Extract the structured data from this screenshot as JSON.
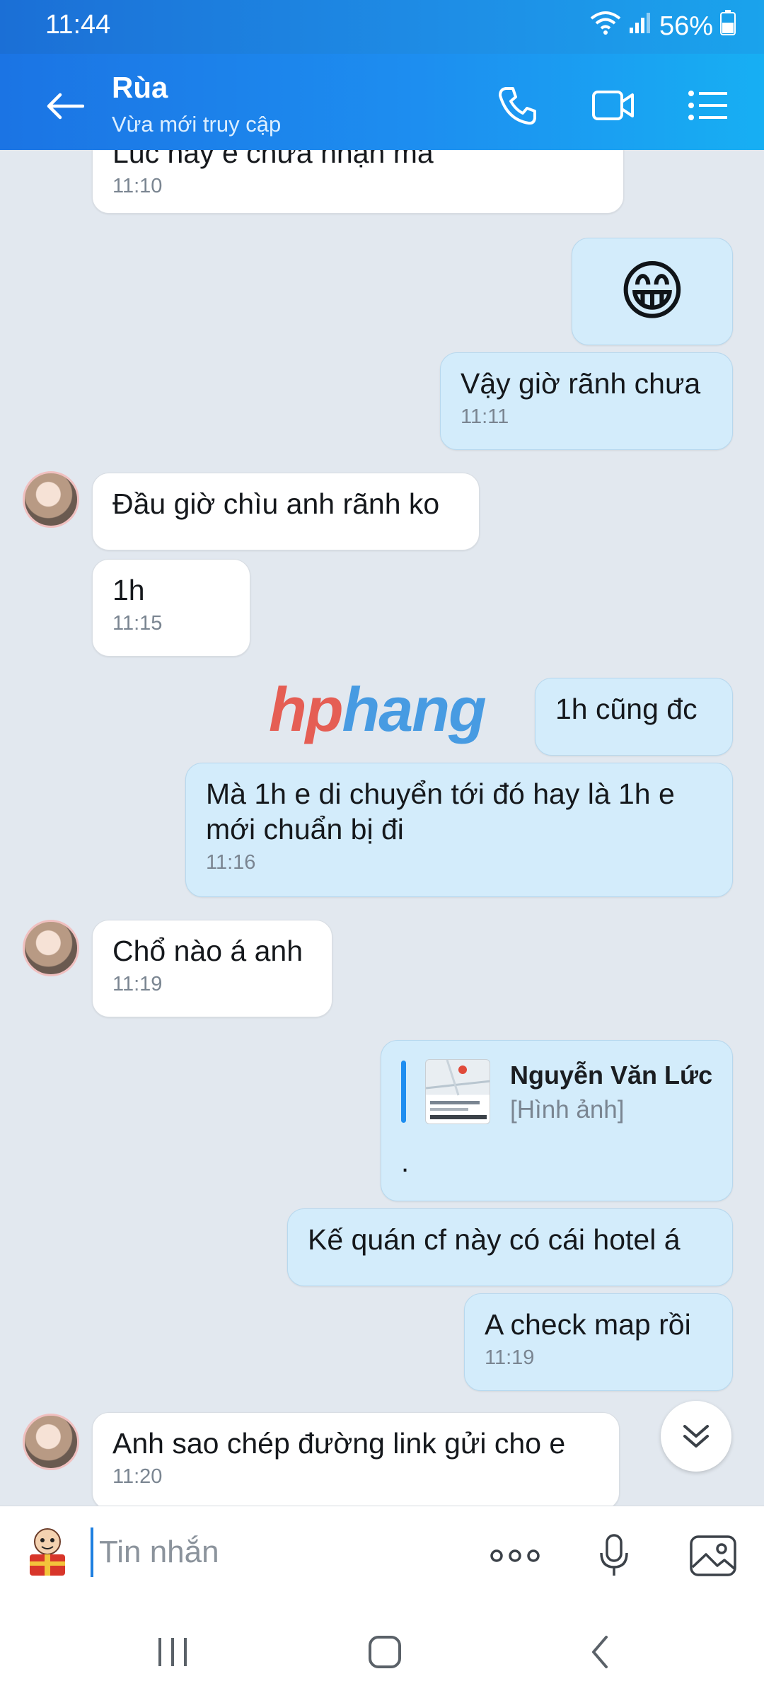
{
  "status": {
    "time": "11:44",
    "battery": "56%"
  },
  "header": {
    "name": "Rùa",
    "status": "Vừa mới truy cập"
  },
  "messages": [
    {
      "text": "Lúc này e chưa nhận mà",
      "time": "11:10"
    },
    {
      "emoji": "😁"
    },
    {
      "text": "Vậy giờ rãnh chưa",
      "time": "11:11"
    },
    {
      "text": "Đầu giờ chìu anh rãnh ko"
    },
    {
      "text": "1h",
      "time": "11:15"
    },
    {
      "text": "1h cũng đc"
    },
    {
      "text": "Mà 1h e di chuyển tới đó hay là 1h e\nmới chuẩn bị đi",
      "time": "11:16"
    },
    {
      "text": "Chổ nào á anh",
      "time": "11:19"
    },
    {
      "reply_name": "Nguyễn Văn Lức",
      "reply_type": "[Hình ảnh]",
      "text": "."
    },
    {
      "text": "Kế quán cf này có cái hotel á"
    },
    {
      "text": "A check map rồi",
      "time": "11:19"
    },
    {
      "text": "Anh sao chép đường link gửi cho e",
      "time": "11:20"
    }
  ],
  "watermark": {
    "part1": "hp",
    "part2": "hang"
  },
  "input": {
    "placeholder": "Tin nhắn"
  },
  "colors": {
    "header": "#1d8ef0",
    "outgoing_bubble": "#d3ecfb",
    "incoming_bubble": "#ffffff",
    "background": "#e2e8ef"
  }
}
